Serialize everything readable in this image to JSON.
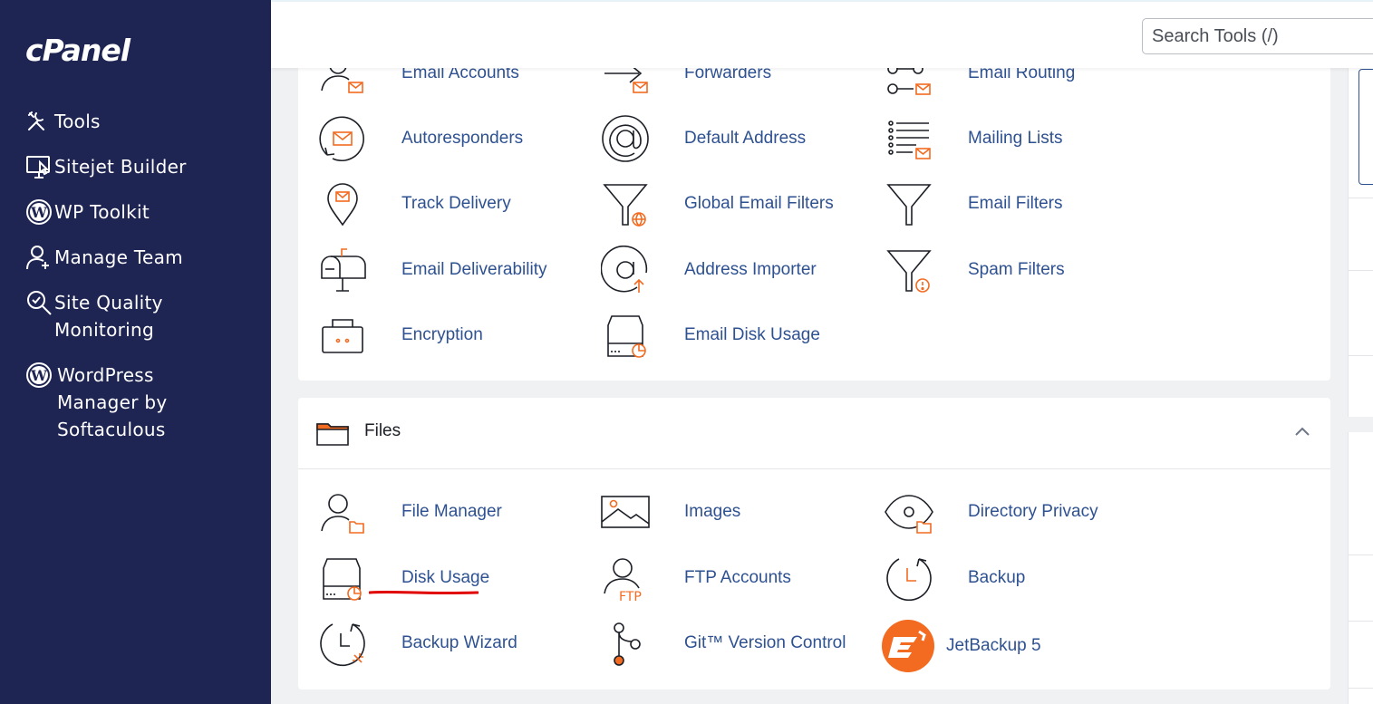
{
  "sidebar": {
    "logo": "cPanel",
    "items": [
      {
        "label": "Tools",
        "icon": "tools-icon"
      },
      {
        "label": "Sitejet Builder",
        "icon": "sitejet-icon"
      },
      {
        "label": "WP Toolkit",
        "icon": "wordpress-icon"
      },
      {
        "label": "Manage Team",
        "icon": "manage-team-icon"
      },
      {
        "label": "Site Quality Monitoring",
        "icon": "site-quality-icon"
      },
      {
        "label": "WordPress Manager by Softaculous",
        "icon": "wordpress-icon"
      }
    ]
  },
  "header": {
    "search_placeholder": "Search Tools (/)"
  },
  "email_section": {
    "tools": [
      {
        "label": "Email Accounts",
        "icon": "email-accounts-icon"
      },
      {
        "label": "Forwarders",
        "icon": "forwarders-icon"
      },
      {
        "label": "Email Routing",
        "icon": "email-routing-icon"
      },
      {
        "label": "Autoresponders",
        "icon": "autoresponders-icon"
      },
      {
        "label": "Default Address",
        "icon": "at-sign-icon"
      },
      {
        "label": "Mailing Lists",
        "icon": "mailing-lists-icon"
      },
      {
        "label": "Track Delivery",
        "icon": "track-delivery-icon"
      },
      {
        "label": "Global Email Filters",
        "icon": "global-filter-icon"
      },
      {
        "label": "Email Filters",
        "icon": "filter-icon"
      },
      {
        "label": "Email Deliverability",
        "icon": "mailbox-icon"
      },
      {
        "label": "Address Importer",
        "icon": "address-importer-icon"
      },
      {
        "label": "Spam Filters",
        "icon": "spam-filter-icon"
      },
      {
        "label": "Encryption",
        "icon": "encryption-icon"
      },
      {
        "label": "Email Disk Usage",
        "icon": "email-disk-usage-icon"
      }
    ]
  },
  "files_section": {
    "title": "Files",
    "tools": [
      {
        "label": "File Manager",
        "icon": "file-manager-icon"
      },
      {
        "label": "Images",
        "icon": "images-icon"
      },
      {
        "label": "Directory Privacy",
        "icon": "directory-privacy-icon"
      },
      {
        "label": "Disk Usage",
        "icon": "disk-usage-icon"
      },
      {
        "label": "FTP Accounts",
        "icon": "ftp-accounts-icon"
      },
      {
        "label": "Backup",
        "icon": "backup-icon"
      },
      {
        "label": "Backup Wizard",
        "icon": "backup-wizard-icon"
      },
      {
        "label": "Git™ Version Control",
        "icon": "git-icon"
      },
      {
        "label": "JetBackup 5",
        "icon": "jetbackup-icon"
      }
    ]
  },
  "colors": {
    "sidebar_bg": "#1f2553",
    "link": "#2e5191",
    "accent_orange": "#f26b21",
    "annotation_red": "#e00000"
  }
}
